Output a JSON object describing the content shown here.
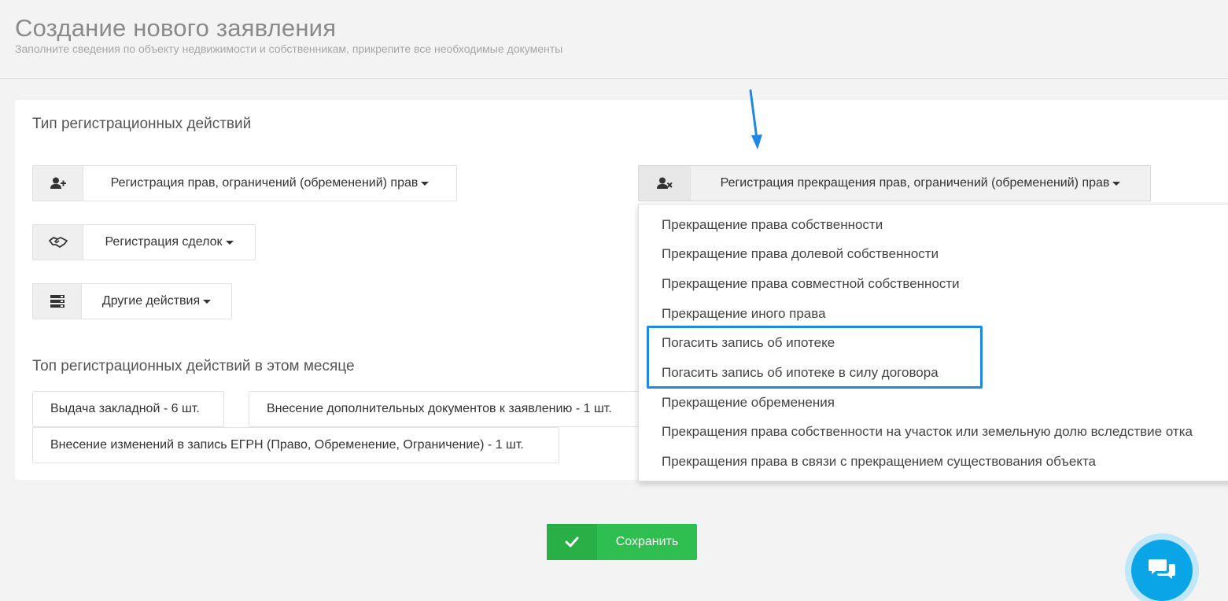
{
  "header": {
    "title": "Создание нового заявления",
    "subtitle": "Заполните сведения по объекту недвижимости и собственникам, прикрепите все необходимые документы"
  },
  "registration_types": {
    "title": "Тип регистрационных действий",
    "buttons": [
      {
        "label": "Регистрация прав, ограничений (обременений) прав",
        "icon": "user-plus-icon"
      },
      {
        "label": "Регистрация сделок",
        "icon": "handshake-icon"
      },
      {
        "label": "Другие действия",
        "icon": "server-icon"
      },
      {
        "label": "Регистрация прекращения прав, ограничений (обременений) прав",
        "icon": "user-times-icon",
        "open": true
      }
    ]
  },
  "dropdown": {
    "items": [
      "Прекращение права собственности",
      "Прекращение права долевой собственности",
      "Прекращение права совместной собственности",
      "Прекращение иного права",
      "Погасить запись об ипотеке",
      "Погасить запись об ипотеке в силу договора",
      "Прекращение обременения",
      "Прекращения права собственности на участок или земельную долю вследствие отка",
      "Прекращения права в связи с прекращением существования объекта"
    ]
  },
  "top_actions": {
    "title": "Топ регистрационных действий в этом месяце",
    "items": [
      "Выдача закладной - 6 шт.",
      "Внесение дополнительных документов к заявлению - 1 шт.",
      "Внесение изменений в запись ЕГРН (Право, Обременение, Ограничение) - 1 шт."
    ]
  },
  "save": {
    "label": "Сохранить",
    "icon": "check-icon"
  },
  "chat": {
    "icon": "chat-icon"
  },
  "colors": {
    "accent_blue": "#1e88e5",
    "save_green": "#2fbf50",
    "chat_blue": "#0aa5e6"
  }
}
